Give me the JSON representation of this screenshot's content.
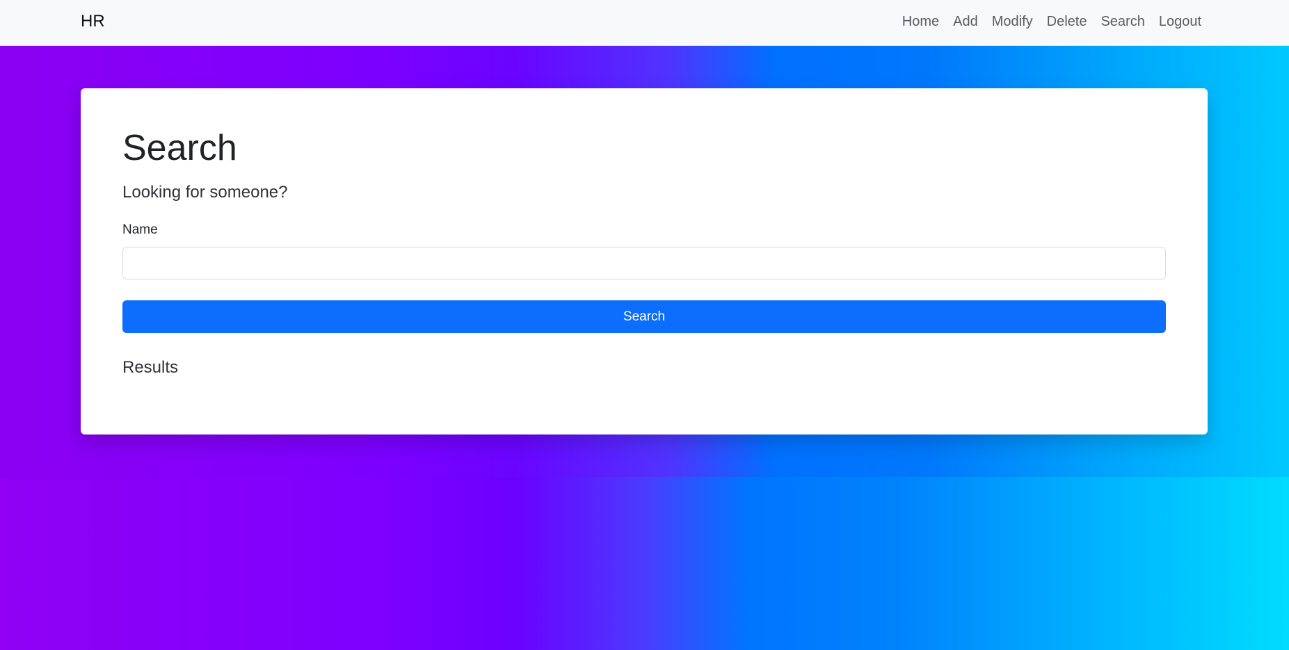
{
  "navbar": {
    "brand": "HR",
    "links": [
      {
        "label": "Home"
      },
      {
        "label": "Add"
      },
      {
        "label": "Modify"
      },
      {
        "label": "Delete"
      },
      {
        "label": "Search"
      },
      {
        "label": "Logout"
      }
    ]
  },
  "search_card": {
    "title": "Search",
    "subtitle": "Looking for someone?",
    "name_label": "Name",
    "name_value": "",
    "button_label": "Search",
    "results_heading": "Results"
  },
  "colors": {
    "primary_button": "#0d6efd",
    "navbar_background": "#f8f9fa",
    "gradient_left": "#8f00f4",
    "gradient_right": "#00dcff"
  }
}
